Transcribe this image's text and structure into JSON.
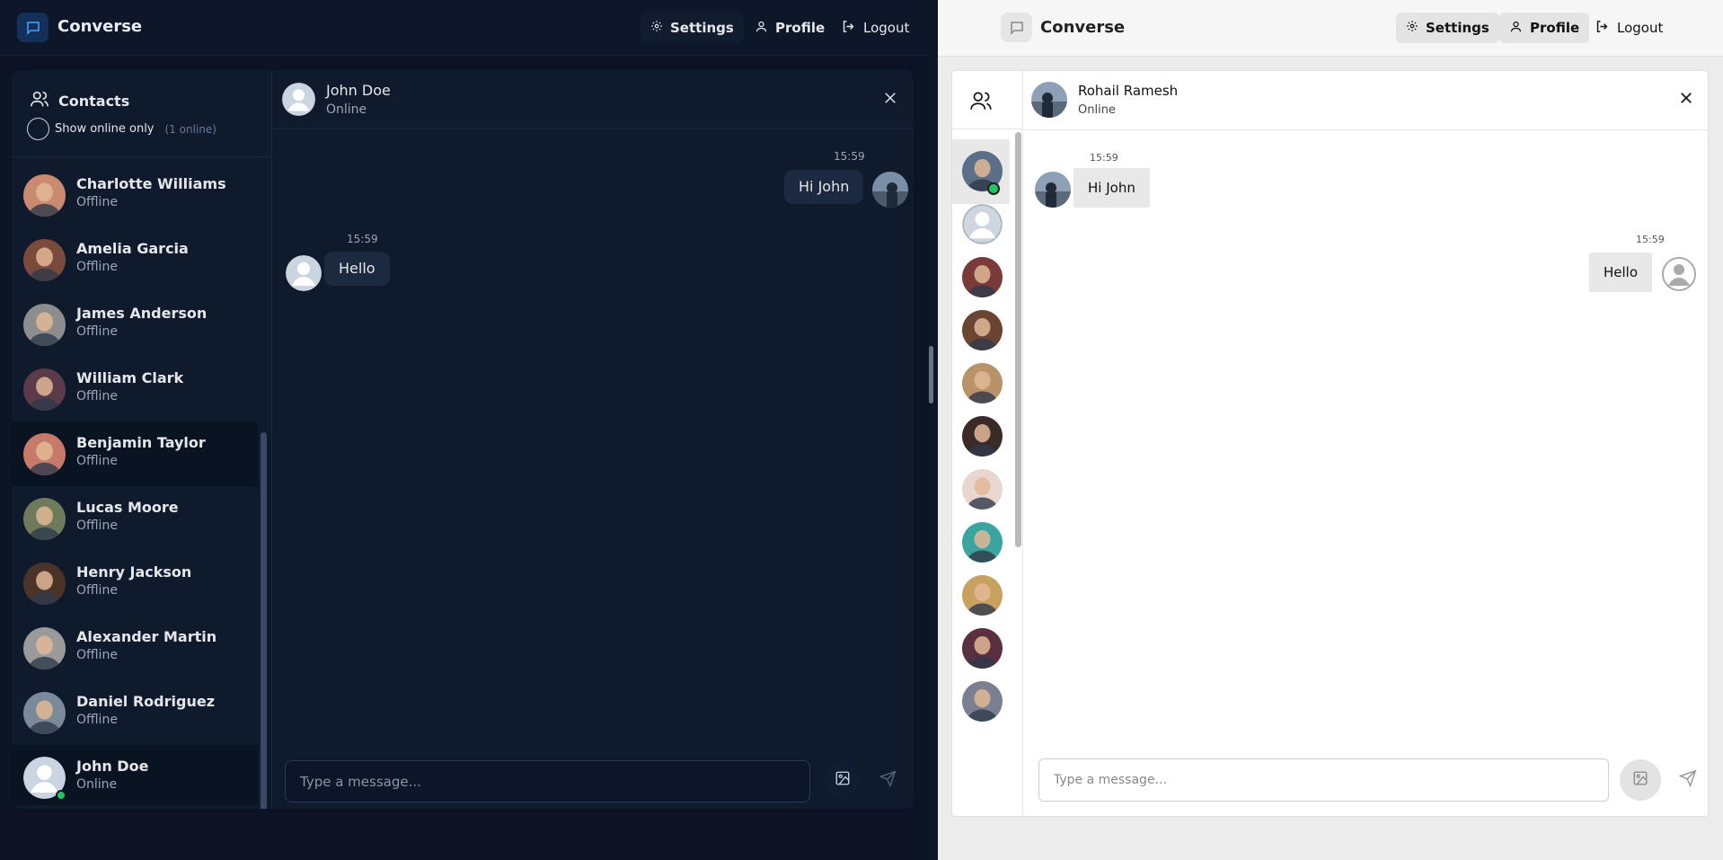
{
  "app": {
    "brand": "Converse",
    "nav": {
      "settings": "Settings",
      "profile": "Profile",
      "logout": "Logout"
    }
  },
  "dark_view": {
    "contacts_heading": "Contacts",
    "online_only_label": "Show online only",
    "online_count": "(1 online)",
    "contacts": [
      {
        "name": "Charlotte Williams",
        "status": "Offline",
        "avatar_color": "#c98a6f"
      },
      {
        "name": "Amelia Garcia",
        "status": "Offline",
        "avatar_color": "#7a4a3c"
      },
      {
        "name": "James Anderson",
        "status": "Offline",
        "avatar_color": "#8d8d8d"
      },
      {
        "name": "William Clark",
        "status": "Offline",
        "avatar_color": "#5b3b4a"
      },
      {
        "name": "Benjamin Taylor",
        "status": "Offline",
        "avatar_color": "#c77a6a"
      },
      {
        "name": "Lucas Moore",
        "status": "Offline",
        "avatar_color": "#6f7a5a"
      },
      {
        "name": "Henry Jackson",
        "status": "Offline",
        "avatar_color": "#4a3428"
      },
      {
        "name": "Alexander Martin",
        "status": "Offline",
        "avatar_color": "#9a9a9a"
      },
      {
        "name": "Daniel Rodriguez",
        "status": "Offline",
        "avatar_color": "#7a8a9a"
      },
      {
        "name": "John Doe",
        "status": "Online",
        "avatar_color": "#cbd5e1"
      }
    ],
    "chat": {
      "name": "John Doe",
      "status": "Online",
      "messages": [
        {
          "time": "15:59",
          "text": "Hi John",
          "side": "right"
        },
        {
          "time": "15:59",
          "text": "Hello",
          "side": "left"
        }
      ],
      "composer_placeholder": "Type a message..."
    }
  },
  "light_view": {
    "chat": {
      "name": "Rohail Ramesh",
      "status": "Online",
      "messages": [
        {
          "time": "15:59",
          "text": "Hi John",
          "side": "left"
        },
        {
          "time": "15:59",
          "text": "Hello",
          "side": "right"
        }
      ],
      "composer_placeholder": "Type a message..."
    },
    "rail_avatar_colors": [
      "#5b7088",
      "#cfd6df",
      "#7a3a3a",
      "#6a4632",
      "#b8936a",
      "#3a2a28",
      "#e9d7cf",
      "#3aa4a0",
      "#c8a060",
      "#5a3040",
      "#7a8090"
    ]
  },
  "colors": {
    "online": "#22c55e",
    "dark_bg": "#0b1324",
    "light_bg": "#ececec"
  }
}
